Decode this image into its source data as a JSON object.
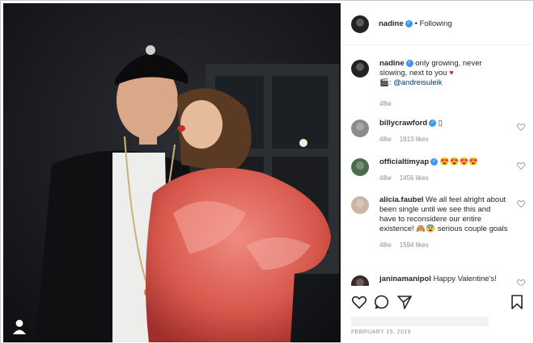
{
  "post": {
    "username": "nadine",
    "follow_status": "• Following"
  },
  "caption": {
    "username": "nadine",
    "text": "only growing, never slowing, next to you",
    "mention": "@andreisuleik",
    "time": "48w"
  },
  "comments": [
    {
      "username": "billycrawford",
      "text": "▯",
      "time": "48w",
      "likes": "1913 likes"
    },
    {
      "username": "officialtimyap",
      "text": "😍😍😍😍",
      "time": "48w",
      "likes": "1456 likes"
    },
    {
      "username": "alicia.faubel",
      "text": "We all feel alright about been single until we see this and have to reconsidere our entire existence! 🙈😨 serious couple goals",
      "time": "48w",
      "likes": "1594 likes"
    },
    {
      "username": "janinamanipol",
      "text": "Happy Valentine's!",
      "time": "",
      "likes": ""
    }
  ],
  "date": "FEBRUARY 15, 2019",
  "icons": [
    "heart-icon",
    "comment-icon",
    "share-icon",
    "bookmark-icon",
    "user-tag-icon",
    "verified-badge-icon"
  ],
  "colors": {
    "verified": "#3897f0",
    "heart_red": "#e0245e",
    "meta": "#8e8e8e"
  }
}
